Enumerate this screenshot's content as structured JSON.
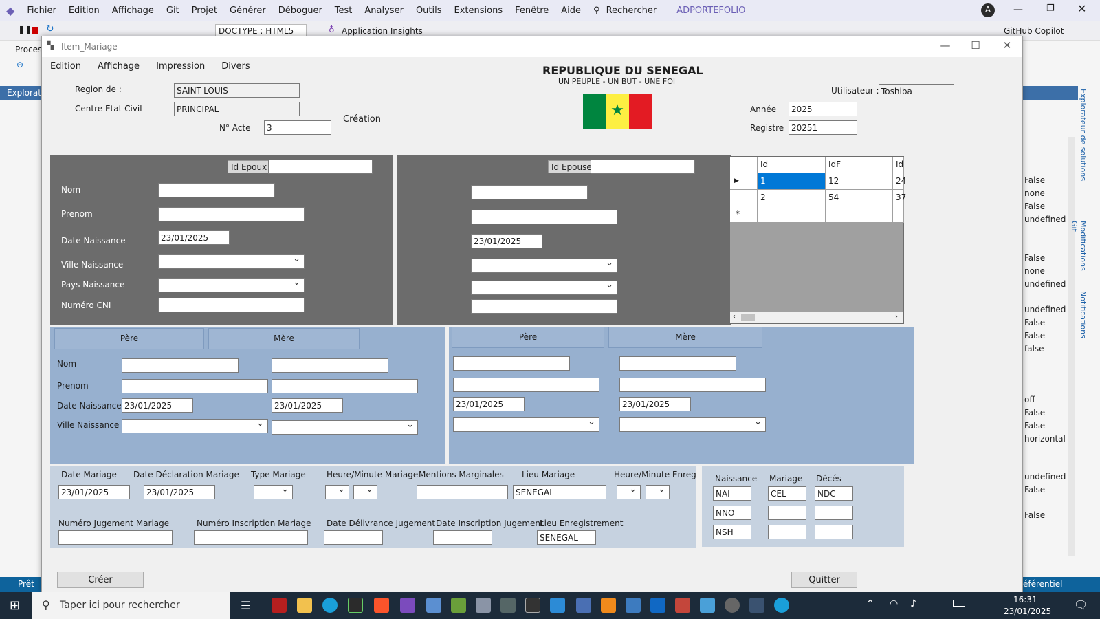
{
  "vs": {
    "menu": [
      "Fichier",
      "Edition",
      "Affichage",
      "Git",
      "Projet",
      "Générer",
      "Déboguer",
      "Test",
      "Analyser",
      "Outils",
      "Extensions",
      "Fenêtre",
      "Aide"
    ],
    "search": "Rechercher",
    "solution": "ADPORTEFOLIO",
    "avatar": "A",
    "doctype": "DOCTYPE : HTML5",
    "insights": "Application Insights",
    "copilot": "GitHub Copilot",
    "proc": "Proces",
    "explorer": "Explorat",
    "side_tabs": [
      "Explorateur de solutions",
      "Modifications Git",
      "Notifications"
    ],
    "prop_values": [
      "False",
      "none",
      "False",
      "undefined",
      "False",
      "none",
      "undefined",
      "undefined",
      "False",
      "False",
      "false",
      "off",
      "False",
      "False",
      "horizontal",
      "undefined",
      "False",
      "False"
    ],
    "status_left": "Prêt",
    "status_right": "éférentiel"
  },
  "dialog": {
    "title": "Item_Mariage",
    "menu": [
      "Edition",
      "Affichage",
      "Impression",
      "Divers"
    ],
    "header": {
      "republique": "REPUBLIQUE DU SENEGAL",
      "devise": "UN PEUPLE - UN BUT - UNE FOI"
    },
    "flag": {
      "green": "#00853f",
      "yellow": "#fdef42",
      "red": "#e31b23"
    },
    "region_label": "Region de :",
    "region": "SAINT-LOUIS",
    "centre_label": "Centre Etat Civil",
    "centre": "PRINCIPAL",
    "acte_label": "N° Acte",
    "acte": "3",
    "creation": "Création",
    "user_label": "Utilisateur :",
    "user": "Toshiba",
    "annee_label": "Année",
    "annee": "2025",
    "registre_label": "Registre",
    "registre": "20251",
    "epoux": {
      "id_label": "Id Epoux",
      "nom": "Nom",
      "prenom": "Prenom",
      "date_label": "Date Naissance",
      "date": "23/01/2025",
      "ville": "Ville Naissance",
      "pays": "Pays Naissance",
      "cni": "Numéro CNI"
    },
    "epouse": {
      "id_label": "Id Epouse",
      "date": "23/01/2025"
    },
    "grid": {
      "headers": [
        "Id",
        "IdF",
        "Id"
      ],
      "rows": [
        [
          "1",
          "12",
          "24"
        ],
        [
          "2",
          "54",
          "37"
        ]
      ],
      "new_row": "*"
    },
    "parents_left": {
      "pere": "Père",
      "mere": "Mère",
      "nom": "Nom",
      "prenom": "Prenom",
      "date_label": "Date Naissance",
      "ville": "Ville Naissance",
      "date_pere": "23/01/2025",
      "date_mere": "23/01/2025"
    },
    "parents_right": {
      "pere": "Père",
      "mere": "Mère",
      "date_pere": "23/01/2025",
      "date_mere": "23/01/2025"
    },
    "mariage": {
      "date_label": "Date Mariage",
      "date": "23/01/2025",
      "decl_label": "Date Déclaration Mariage",
      "decl": "23/01/2025",
      "type_label": "Type Mariage",
      "heure_label": "Heure/Minute Mariage",
      "mentions_label": "Mentions Marginales",
      "lieu_label": "Lieu Mariage",
      "lieu": "SENEGAL",
      "heure_enreg_label": "Heure/Minute Enreg",
      "jug_label": "Numéro Jugement Mariage",
      "insc_label": "Numéro Inscription Mariage",
      "deliv_label": "Date Délivrance Jugement",
      "date_insc_label": "Date Inscription Jugement",
      "lieu_enreg_label": "Lieu Enregistrement",
      "lieu_enreg": "SENEGAL"
    },
    "codes": {
      "naissance": "Naissance",
      "mariage": "Mariage",
      "deces": "Décés",
      "nai": "NAI",
      "cel": "CEL",
      "ndc": "NDC",
      "nno": "NNO",
      "nsh": "NSH"
    },
    "btn_creer": "Créer",
    "btn_quitter": "Quitter"
  },
  "taskbar": {
    "search": "Taper ici pour rechercher",
    "time": "16:31",
    "date": "23/01/2025"
  }
}
